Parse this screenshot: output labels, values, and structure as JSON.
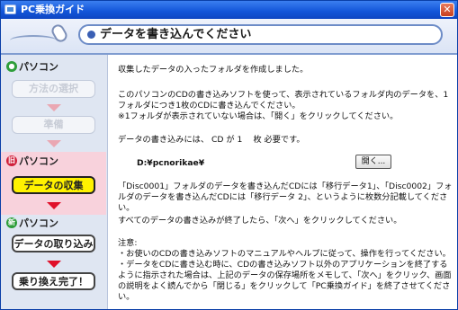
{
  "window": {
    "title": "PC乗換ガイド",
    "close_glyph": "✕"
  },
  "header": {
    "title": "データを書き込んでください"
  },
  "sidebar": {
    "section1_label": "パソコン",
    "section1_badge": "",
    "step_method": "方法の選択",
    "step_prepare": "準備",
    "section2_label": "パソコン",
    "section2_badge": "旧",
    "step_collect": "データの収集",
    "section3_label": "パソコン",
    "section3_badge": "新",
    "step_import": "データの取り込み",
    "step_complete": "乗り換え完了！"
  },
  "main": {
    "line1": "収集したデータの入ったフォルダを作成しました。",
    "para2": "このパソコンのCDの書き込みソフトを使って、表示されているフォルダ内のデータを、1フォルダにつき1枚のCDに書き込んでください。",
    "para2_note": "※1フォルダが表示されていない場合は、「開く」をクリックしてください。",
    "cd_required": "データの書き込みには、 CD が 1 　枚 必要です。",
    "drive_path": "D:¥pcnorikae¥",
    "open_button": "開く...",
    "para3": "「Disc0001」フォルダのデータを書き込んだCDには「移行データ1」、「Disc0002」フォルダのデータを書き込んだCDには「移行データ 2」、というように枚数分記載してください。",
    "para4": "すべてのデータの書き込みが終了したら、「次へ」をクリックしてください。",
    "notes_title": "注意:",
    "note1": "・お使いのCDの書き込みソフトのマニュアルやヘルプに従って、操作を行ってください。",
    "note2": "・データをCDに書き込む時に、CDの書き込みソフト以外のアプリケーションを終了するように指示された場合は、上記のデータの保存場所をメモして、「次へ」をクリック、画面の説明をよく読んでから「閉じる」をクリックして「PC乗換ガイド」を終了させてください。"
  },
  "colors": {
    "titlebar": "#1254d8",
    "active_step": "#fff200",
    "old_band": "#f8d2dc",
    "arrow_red": "#e0102a",
    "badge_green": "#2e9e3a",
    "badge_red": "#d0203a"
  }
}
